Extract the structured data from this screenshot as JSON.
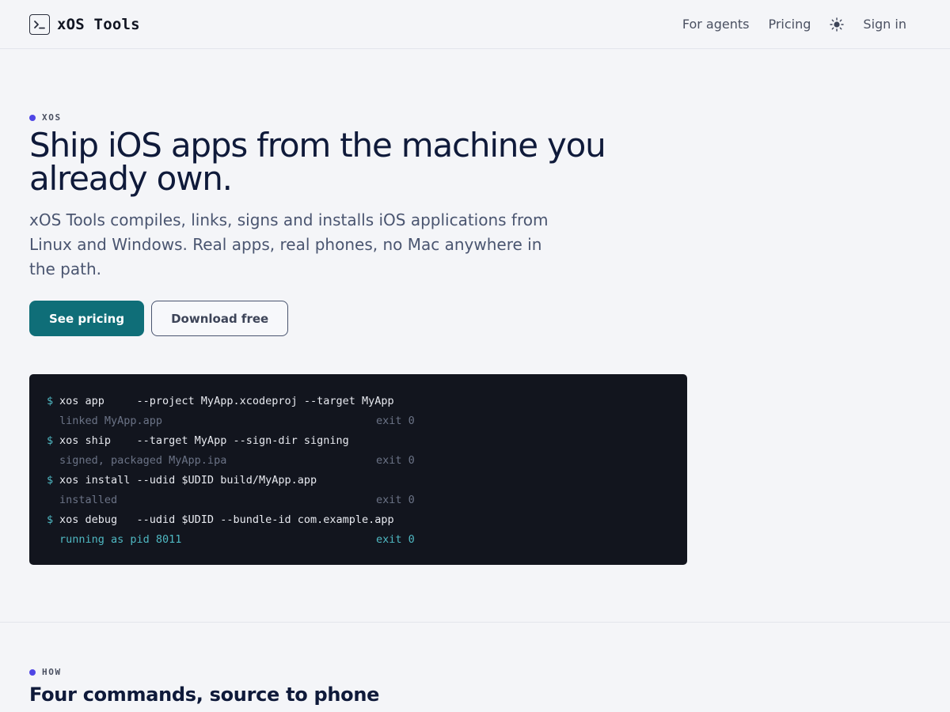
{
  "header": {
    "brand": "xOS Tools",
    "nav": {
      "agents": "For agents",
      "pricing": "Pricing",
      "signin": "Sign in"
    }
  },
  "hero": {
    "eyebrow": "XOS",
    "title": "Ship iOS apps from the machine you already own.",
    "subtitle": "xOS Tools compiles, links, signs and installs iOS applications from Linux and Windows. Real apps, real phones, no Mac anywhere in the path.",
    "cta_primary": "See pricing",
    "cta_secondary": "Download free"
  },
  "terminal": {
    "lines": [
      {
        "kind": "cmd",
        "text": "xos app     --project MyApp.xcodeproj --target MyApp"
      },
      {
        "kind": "out",
        "text": "linked MyApp.app",
        "exit": "exit 0"
      },
      {
        "kind": "cmd",
        "text": "xos ship    --target MyApp --sign-dir signing"
      },
      {
        "kind": "out",
        "text": "signed, packaged MyApp.ipa",
        "exit": "exit 0"
      },
      {
        "kind": "cmd",
        "text": "xos install --udid $UDID build/MyApp.app"
      },
      {
        "kind": "out",
        "text": "installed",
        "exit": "exit 0"
      },
      {
        "kind": "cmd",
        "text": "xos debug   --udid $UDID --bundle-id com.example.app"
      },
      {
        "kind": "out-ok",
        "text": "running as pid 8011",
        "exit": "exit 0"
      }
    ],
    "prompt": "$"
  },
  "how": {
    "eyebrow": "HOW",
    "title": "Four commands, source to phone"
  },
  "colors": {
    "accent": "#4f46e5",
    "primary_button": "#0f6e78",
    "terminal_bg": "#12151e",
    "terminal_highlight": "#4fb8c2"
  },
  "icons": {
    "brand": "terminal-prompt-icon",
    "theme": "sun-icon"
  }
}
